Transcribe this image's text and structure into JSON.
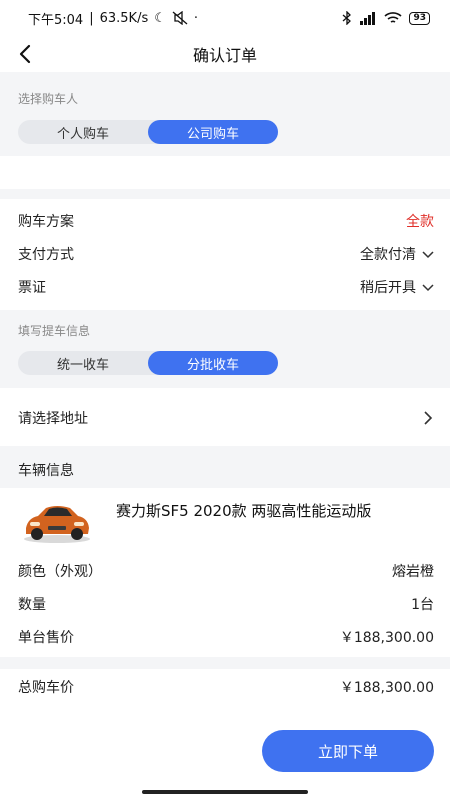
{
  "status_bar": {
    "time": "下午5:04",
    "speed": "63.5K/s",
    "battery": "93"
  },
  "header": {
    "title": "确认订单"
  },
  "buyer": {
    "label": "选择购车人",
    "options": [
      "个人购车",
      "公司购车"
    ],
    "selected": "公司购车"
  },
  "plan": {
    "rows": [
      {
        "label": "购车方案",
        "value": "全款"
      },
      {
        "label": "支付方式",
        "value": "全款付清"
      },
      {
        "label": "票证",
        "value": "稍后开具"
      }
    ]
  },
  "pickup": {
    "label": "填写提车信息",
    "options": [
      "统一收车",
      "分批收车"
    ],
    "selected": "分批收车"
  },
  "address": {
    "label": "请选择地址"
  },
  "vehicle": {
    "section_title": "车辆信息",
    "name": "赛力斯SF5 2020款 两驱高性能运动版",
    "rows": [
      {
        "label": "颜色（外观）",
        "value": "熔岩橙"
      },
      {
        "label": "数量",
        "value": "1台"
      },
      {
        "label": "单台售价",
        "value": "￥188,300.00"
      }
    ]
  },
  "total": {
    "label": "总购车价",
    "value": "￥188,300.00"
  },
  "submit": {
    "label": "立即下单"
  },
  "colors": {
    "accent": "#3f72f0",
    "price_red": "#e0302a",
    "section_bg": "#f4f5f7",
    "car_body": "#d2631f"
  }
}
